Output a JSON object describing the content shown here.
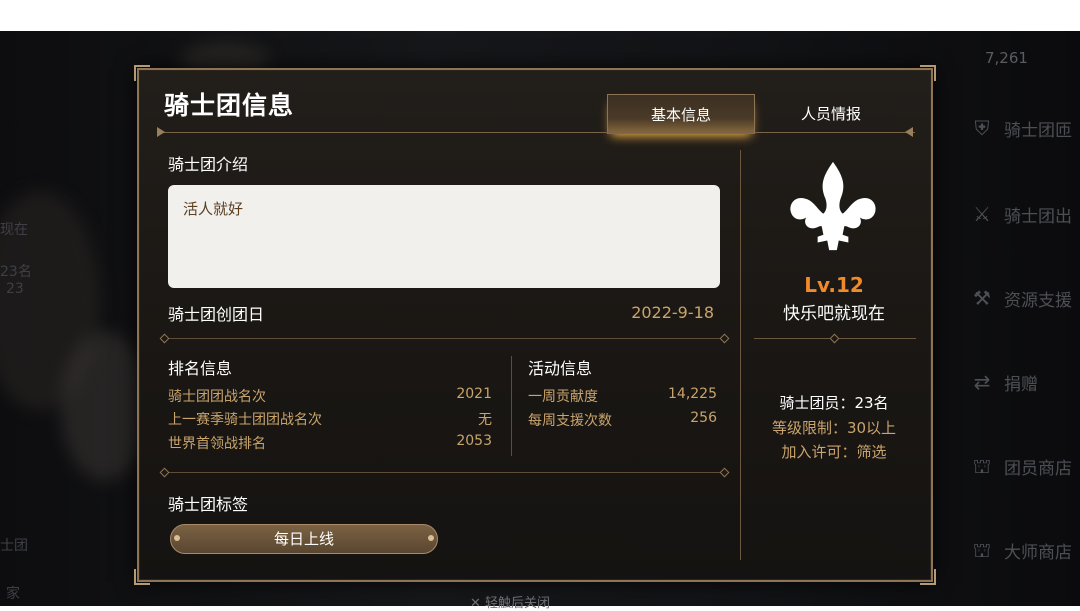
{
  "background": {
    "top_hud": {
      "currency": "7,261"
    },
    "right_menu": [
      {
        "label": "骑士团匝",
        "icon": "shield-icon"
      },
      {
        "label": "骑士团出",
        "icon": "swords-icon"
      },
      {
        "label": "资源支援",
        "icon": "tools-icon"
      },
      {
        "label": "捐赠",
        "icon": "shuffle-icon"
      },
      {
        "label": "团员商店",
        "icon": "shop-icon"
      },
      {
        "label": "大师商店",
        "icon": "master-shop-icon"
      }
    ],
    "left_fragments": [
      "现在",
      "23名",
      "23",
      "士团",
      "家"
    ]
  },
  "dialog": {
    "title": "骑士团信息",
    "tabs": [
      {
        "label": "基本信息",
        "active": true
      },
      {
        "label": "人员情报",
        "active": false
      }
    ],
    "intro": {
      "label": "骑士团介绍",
      "text": "活人就好"
    },
    "founded": {
      "label": "骑士团创团日",
      "value": "2022-9-18"
    },
    "ranking": {
      "label": "排名信息",
      "rows": [
        {
          "label": "骑士团团战名次",
          "value": "2021"
        },
        {
          "label": "上一赛季骑士团团战名次",
          "value": "无"
        },
        {
          "label": "世界首领战排名",
          "value": "2053"
        }
      ]
    },
    "activity": {
      "label": "活动信息",
      "rows": [
        {
          "label": "一周贡献度",
          "value": "14,225"
        },
        {
          "label": "每周支援次数",
          "value": "256"
        }
      ]
    },
    "tags": {
      "label": "骑士团标签",
      "items": [
        "每日上线"
      ]
    },
    "guild": {
      "emblem": "fleur-de-lis-icon",
      "level": "Lv.12",
      "name": "快乐吧就现在",
      "members": "骑士团员：23名",
      "level_limit": "等级限制：30以上",
      "join_permission": "加入许可：筛选"
    },
    "close_hint": "轻触后关闭"
  },
  "colors": {
    "accent_gold": "#c9a46c",
    "level_orange": "#f08a2a",
    "frame": "#8c7455"
  }
}
